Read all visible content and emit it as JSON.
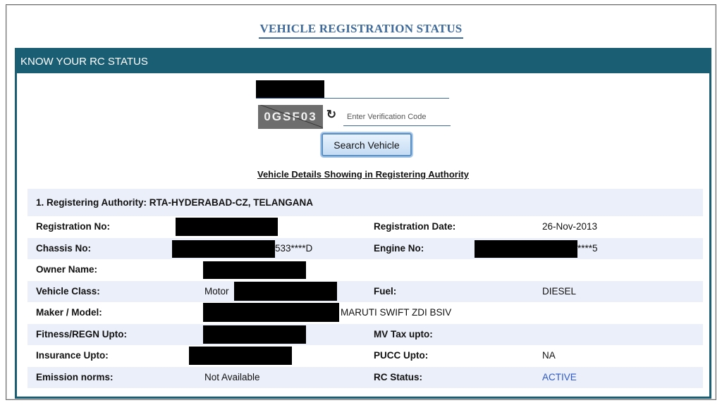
{
  "page": {
    "title": "VEHICLE REGISTRATION STATUS"
  },
  "panel": {
    "header": "KNOW YOUR RC STATUS"
  },
  "search": {
    "captcha_text": "0GSF03",
    "code_placeholder": "Enter Verification Code",
    "button_label": "Search Vehicle"
  },
  "details": {
    "title": "Vehicle Details Showing in Registering Authority",
    "authority": "1. Registering Authority: RTA-HYDERABAD-CZ, TELANGANA",
    "rows": [
      {
        "label1": "Registration No:",
        "value1": "",
        "label2": "Registration Date:",
        "value2": "26-Nov-2013"
      },
      {
        "label1": "Chassis No:",
        "value1": "533****D",
        "label2": "Engine No:",
        "value2": "****5"
      },
      {
        "label1": "Owner Name:",
        "value1": "",
        "label2": "",
        "value2": ""
      },
      {
        "label1": "Vehicle Class:",
        "value1": "Motor",
        "label2": "Fuel:",
        "value2": "DIESEL"
      },
      {
        "label1": "Maker / Model:",
        "value1": "MARUTI SWIFT ZDI BSIV",
        "label2": "",
        "value2": ""
      },
      {
        "label1": "Fitness/REGN Upto:",
        "value1": "",
        "label2": "MV Tax upto:",
        "value2": ""
      },
      {
        "label1": "Insurance Upto:",
        "value1": "",
        "label2": "PUCC Upto:",
        "value2": "NA"
      },
      {
        "label1": "Emission norms:",
        "value1": "Not Available",
        "label2": "RC Status:",
        "value2": "ACTIVE"
      }
    ]
  },
  "colors": {
    "header_bg": "#1a5e74",
    "title_blue": "#3d6a9b",
    "row_shade": "#ebeff9",
    "status_active": "#2b57c9"
  }
}
